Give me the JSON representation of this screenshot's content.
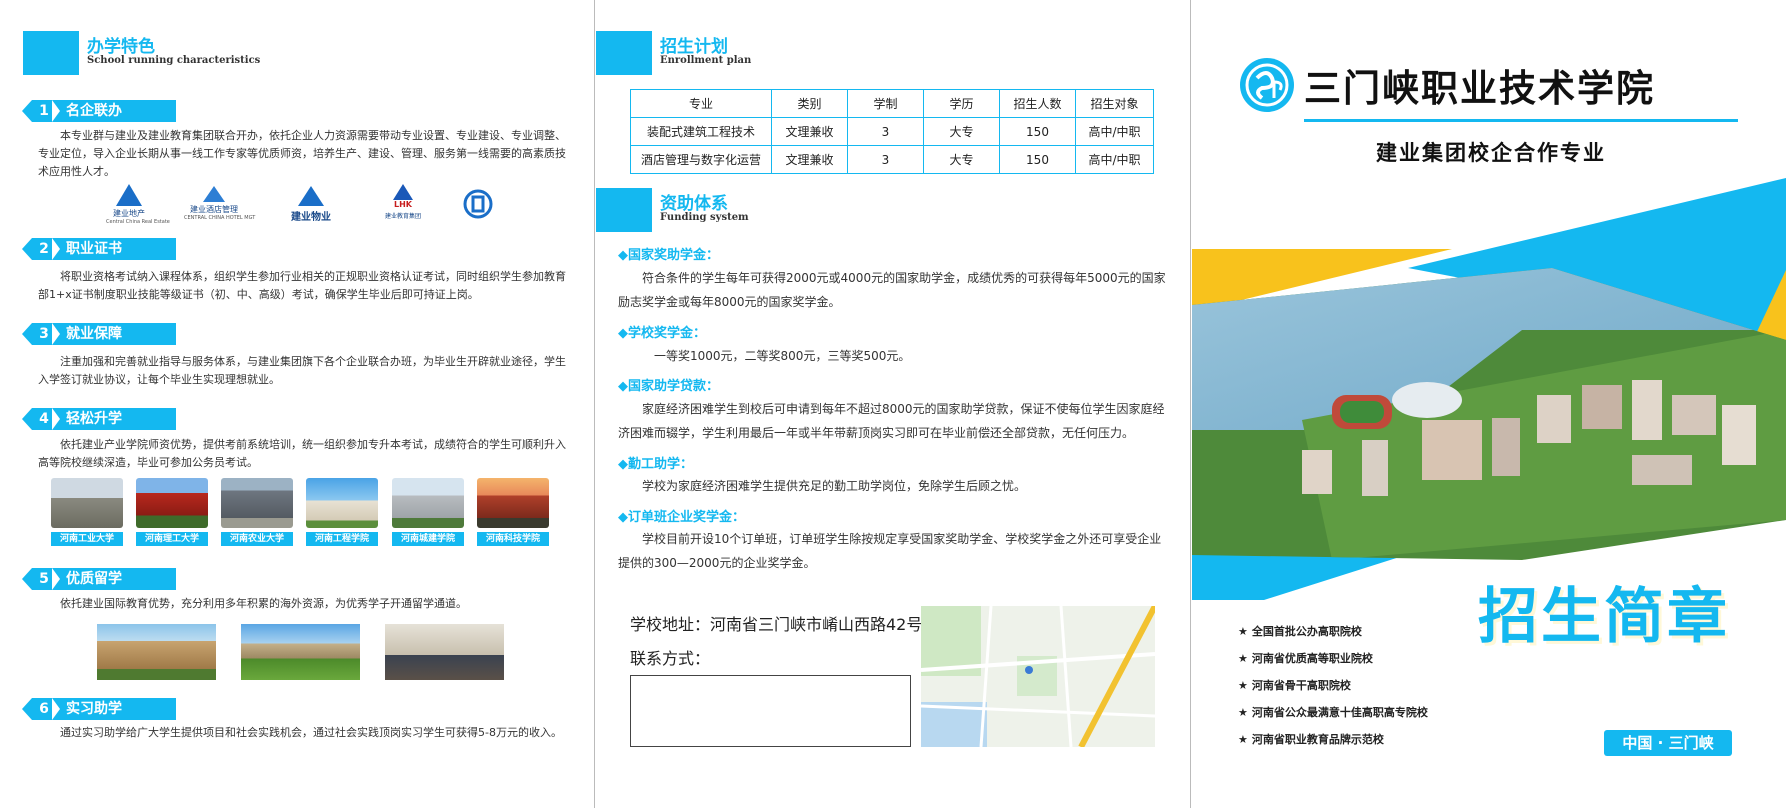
{
  "left": {
    "header": {
      "cn": "办学特色",
      "en": "School running characteristics"
    },
    "items": [
      {
        "num": "1",
        "title": "名企联办",
        "text": "本专业群与建业及建业教育集团联合开办，依托企业人力资源需要带动专业设置、专业建设、专业调整、专业定位，导入企业长期从事一线工作专家等优质师资，培养生产、建设、管理、服务第一线需要的高素质技术应用性人才。"
      },
      {
        "num": "2",
        "title": "职业证书",
        "text": "将职业资格考试纳入课程体系，组织学生参加行业相关的正规职业资格认证考试，同时组织学生参加教育部1+x证书制度职业技能等级证书（初、中、高级）考试，确保学生毕业后即可持证上岗。"
      },
      {
        "num": "3",
        "title": "就业保障",
        "text": "注重加强和完善就业指导与服务体系，与建业集团旗下各个企业联合办班，为毕业生开辟就业途径，学生入学签订就业协议，让每个毕业生实现理想就业。"
      },
      {
        "num": "4",
        "title": "轻松升学",
        "text": "依托建业产业学院师资优势，提供考前系统培训，统一组织参加专升本考试，成绩符合的学生可顺利升入高等院校继续深造，毕业可参加公务员考试。"
      },
      {
        "num": "5",
        "title": "优质留学",
        "text": "依托建业国际教育优势，充分利用多年积累的海外资源，为优秀学子开通留学通道。"
      },
      {
        "num": "6",
        "title": "实习助学",
        "text": "通过实习助学给广大学生提供项目和社会实践机会，通过社会实践顶岗实习学生可获得5-8万元的收入。"
      }
    ],
    "logos": [
      {
        "name": "建业地产",
        "sub": "Central China Real Estate"
      },
      {
        "name": "建业酒店管理",
        "sub": "CENTRAL CHINA HOTEL MGT"
      },
      {
        "name": "建业物业",
        "sub": ""
      },
      {
        "name": "建业教育集团",
        "sub": ""
      },
      {
        "name": "",
        "sub": ""
      }
    ],
    "logo_badge": "LHK",
    "universities": [
      "河南工业大学",
      "河南理工大学",
      "河南农业大学",
      "河南工程学院",
      "河南城建学院",
      "河南科技学院"
    ]
  },
  "middle": {
    "enroll_header": {
      "cn": "招生计划",
      "en": "Enrollment plan"
    },
    "table": {
      "headers": [
        "专业",
        "类别",
        "学制",
        "学历",
        "招生人数",
        "招生对象"
      ],
      "rows": [
        [
          "装配式建筑工程技术",
          "文理兼收",
          "3",
          "大专",
          "150",
          "高中/中职"
        ],
        [
          "酒店管理与数字化运营",
          "文理兼收",
          "3",
          "大专",
          "150",
          "高中/中职"
        ]
      ]
    },
    "fund_header": {
      "cn": "资助体系",
      "en": "Funding system"
    },
    "funding": [
      {
        "title": "◆国家奖助学金：",
        "text": "符合条件的学生每年可获得2000元或4000元的国家助学金，成绩优秀的可获得每年5000元的国家励志奖学金或每年8000元的国家奖学金。"
      },
      {
        "title": "◆学校奖学金：",
        "text": "一等奖1000元，二等奖800元，三等奖500元。"
      },
      {
        "title": "◆国家助学贷款：",
        "text": "家庭经济困难学生到校后可申请到每年不超过8000元的国家助学贷款，保证不使每位学生因家庭经济困难而辍学，学生利用最后一年或半年带薪顶岗实习即可在毕业前偿还全部贷款，无任何压力。"
      },
      {
        "title": "◆勤工助学：",
        "text": "学校为家庭经济困难学生提供充足的勤工助学岗位，免除学生后顾之忧。"
      },
      {
        "title": "◆订单班企业奖学金：",
        "text": "学校目前开设10个订单班，订单班学生除按规定享受国家奖助学金、学校奖学金之外还可享受企业提供的300—2000元的企业奖学金。"
      }
    ],
    "address": "学校地址：河南省三门峡市崤山西路42号",
    "contact": "联系方式："
  },
  "right": {
    "school_name": "三门峡职业技术学院",
    "subtitle": "建业集团校企合作专业",
    "brochure_title": "招生简章",
    "honors": [
      "全国首批公办高职院校",
      "河南省优质高等职业院校",
      "河南省骨干高职院校",
      "河南省公众最满意十佳高职高专院校",
      "河南省职业教育品牌示范校"
    ],
    "star": "★",
    "location": "中国 · 三门峡"
  },
  "colors": {
    "accent": "#14b8f0",
    "yellow": "#f8c21c",
    "text": "#333333"
  }
}
